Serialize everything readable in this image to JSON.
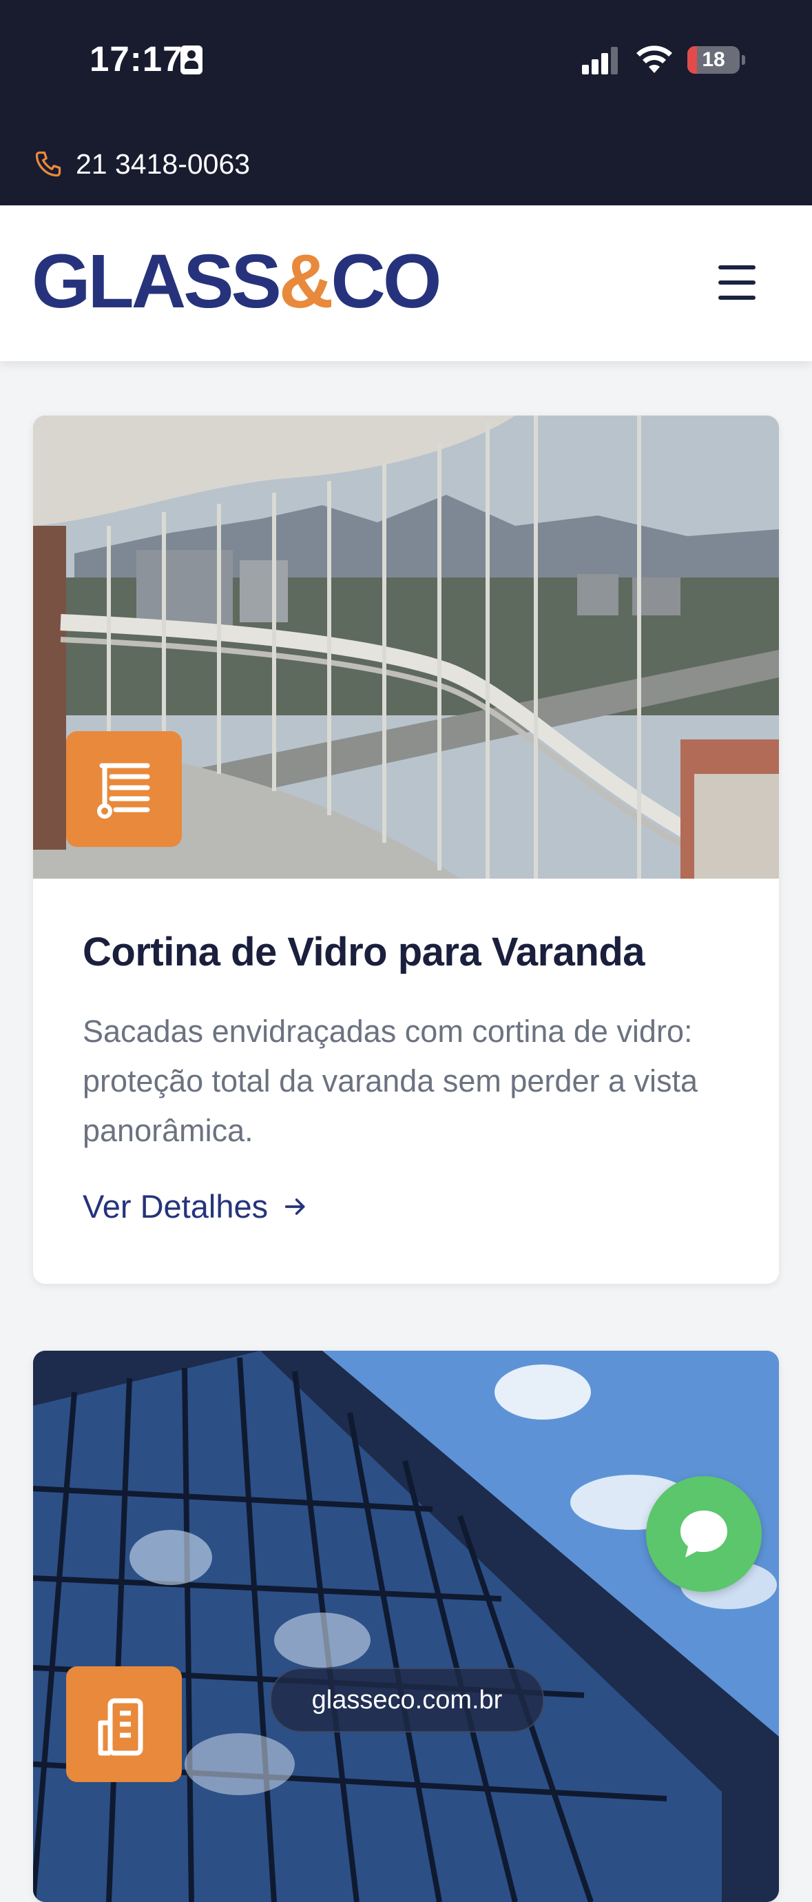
{
  "status_bar": {
    "time": "17:17",
    "battery": "18",
    "battery_level": 0.18,
    "signal_bars": 3
  },
  "top_bar": {
    "phone": "21 3418-0063",
    "phone_icon": "phone-icon",
    "accent_color": "#e8893b",
    "background_color": "#191b2f"
  },
  "header": {
    "logo_part1": "GLASS",
    "logo_amp": "&",
    "logo_part2": "CO",
    "brand_color": "#26337c",
    "menu_icon": "hamburger-menu-icon"
  },
  "cards": [
    {
      "title": "Cortina de Vidro para Varanda",
      "description": "Sacadas envidraçadas com cortina de vidro: proteção total da varanda sem perder a vista panorâmica.",
      "link_label": "Ver Detalhes",
      "badge_icon": "glass-curtain-icon",
      "image": "balcony-glass-curtain-photo"
    },
    {
      "badge_icon": "building-icon",
      "image": "glass-facade-building-photo"
    }
  ],
  "floating": {
    "chat_icon": "chat-bubble-icon",
    "chat_color": "#5bc66b",
    "url": "glasseco.com.br"
  }
}
